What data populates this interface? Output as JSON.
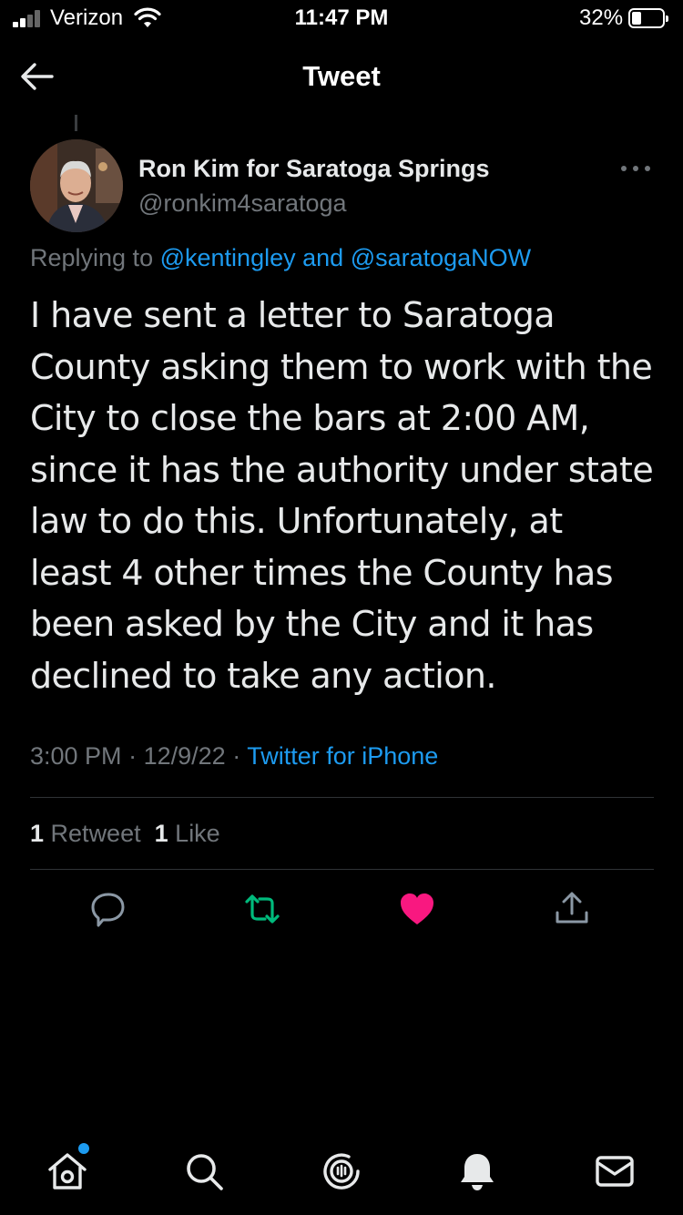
{
  "status_bar": {
    "carrier": "Verizon",
    "time": "11:47 PM",
    "battery": "32%",
    "battery_level": 0.32
  },
  "header": {
    "title": "Tweet"
  },
  "tweet": {
    "author_name": "Ron Kim for Saratoga Springs",
    "author_handle": "@ronkim4saratoga",
    "replying_prefix": "Replying to",
    "reply_to_1": "@kentingley",
    "reply_and": "and",
    "reply_to_2": "@saratogaNOW",
    "text": "I have sent a letter to Saratoga\nCounty asking them to work with the\nCity to close the bars at 2:00 AM,\nsince it has the authority under state\nlaw to do this.  Unfortunately, at\nleast 4 other times the County has\nbeen asked by the City and it has\ndeclined to take any action.",
    "time": "3:00 PM",
    "separator": "·",
    "date": "12/9/22",
    "source": "Twitter for iPhone",
    "retweet_count": "1",
    "retweet_label": "Retweet",
    "like_count": "1",
    "like_label": "Like"
  },
  "actions": {
    "reply_icon": "reply-icon",
    "retweet_icon": "retweet-icon",
    "like_icon": "heart-icon",
    "share_icon": "share-icon",
    "retweet_color": "#00ba7c",
    "like_color": "#f91880"
  },
  "tab_bar": {
    "items": [
      "home-icon",
      "search-icon",
      "spaces-icon",
      "notifications-icon",
      "messages-icon"
    ],
    "badge_color": "#1d9bf0"
  }
}
